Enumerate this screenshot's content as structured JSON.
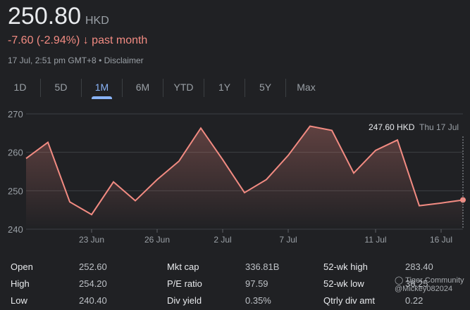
{
  "quote": {
    "price": "250.80",
    "currency": "HKD",
    "change": "-7.60 (-2.94%)",
    "arrow": "↓",
    "period": "past month",
    "timestamp": "17 Jul, 2:51 pm GMT+8",
    "separator": "•",
    "disclaimer": "Disclaimer"
  },
  "tabs": [
    "1D",
    "5D",
    "1M",
    "6M",
    "YTD",
    "1Y",
    "5Y",
    "Max"
  ],
  "active_tab": "1M",
  "tooltip": {
    "value": "247.60 HKD",
    "date": "Thu 17 Jul"
  },
  "colors": {
    "line": "#f28b82",
    "accent": "#8ab4f8"
  },
  "chart_data": {
    "type": "line",
    "title": "",
    "xlabel": "",
    "ylabel": "",
    "ylim": [
      240,
      270
    ],
    "grid": true,
    "yticks": [
      "270",
      "260",
      "250",
      "240"
    ],
    "xticks": [
      {
        "label": "23 Jun",
        "index": 3
      },
      {
        "label": "26 Jun",
        "index": 6
      },
      {
        "label": "2 Jul",
        "index": 9
      },
      {
        "label": "7 Jul",
        "index": 12
      },
      {
        "label": "11 Jul",
        "index": 16
      },
      {
        "label": "16 Jul",
        "index": 19
      }
    ],
    "x": [
      "18 Jun",
      "19 Jun",
      "20 Jun",
      "23 Jun",
      "24 Jun",
      "25 Jun",
      "26 Jun",
      "27 Jun",
      "30 Jun",
      "2 Jul",
      "3 Jul",
      "4 Jul",
      "7 Jul",
      "8 Jul",
      "9 Jul",
      "10 Jul",
      "11 Jul",
      "14 Jul",
      "15 Jul",
      "16 Jul",
      "17 Jul"
    ],
    "values": [
      258.4,
      262.6,
      247.1,
      243.8,
      252.3,
      247.4,
      252.9,
      257.7,
      266.3,
      258.1,
      249.5,
      252.9,
      259.2,
      266.8,
      265.7,
      254.6,
      260.5,
      263.2,
      246.1,
      246.8,
      247.6
    ]
  },
  "stats": [
    [
      {
        "label": "Open",
        "value": "252.60"
      },
      {
        "label": "High",
        "value": "254.20"
      },
      {
        "label": "Low",
        "value": "240.40"
      }
    ],
    [
      {
        "label": "Mkt cap",
        "value": "336.81B"
      },
      {
        "label": "P/E ratio",
        "value": "97.59"
      },
      {
        "label": "Div yield",
        "value": "0.35%"
      }
    ],
    [
      {
        "label": "52-wk high",
        "value": "283.40"
      },
      {
        "label": "52-wk low",
        "value": "36.25"
      },
      {
        "label": "Qtrly div amt",
        "value": "0.22"
      }
    ]
  ],
  "watermark": {
    "brand": "Tiger Community",
    "user": "@Mickey082024"
  }
}
